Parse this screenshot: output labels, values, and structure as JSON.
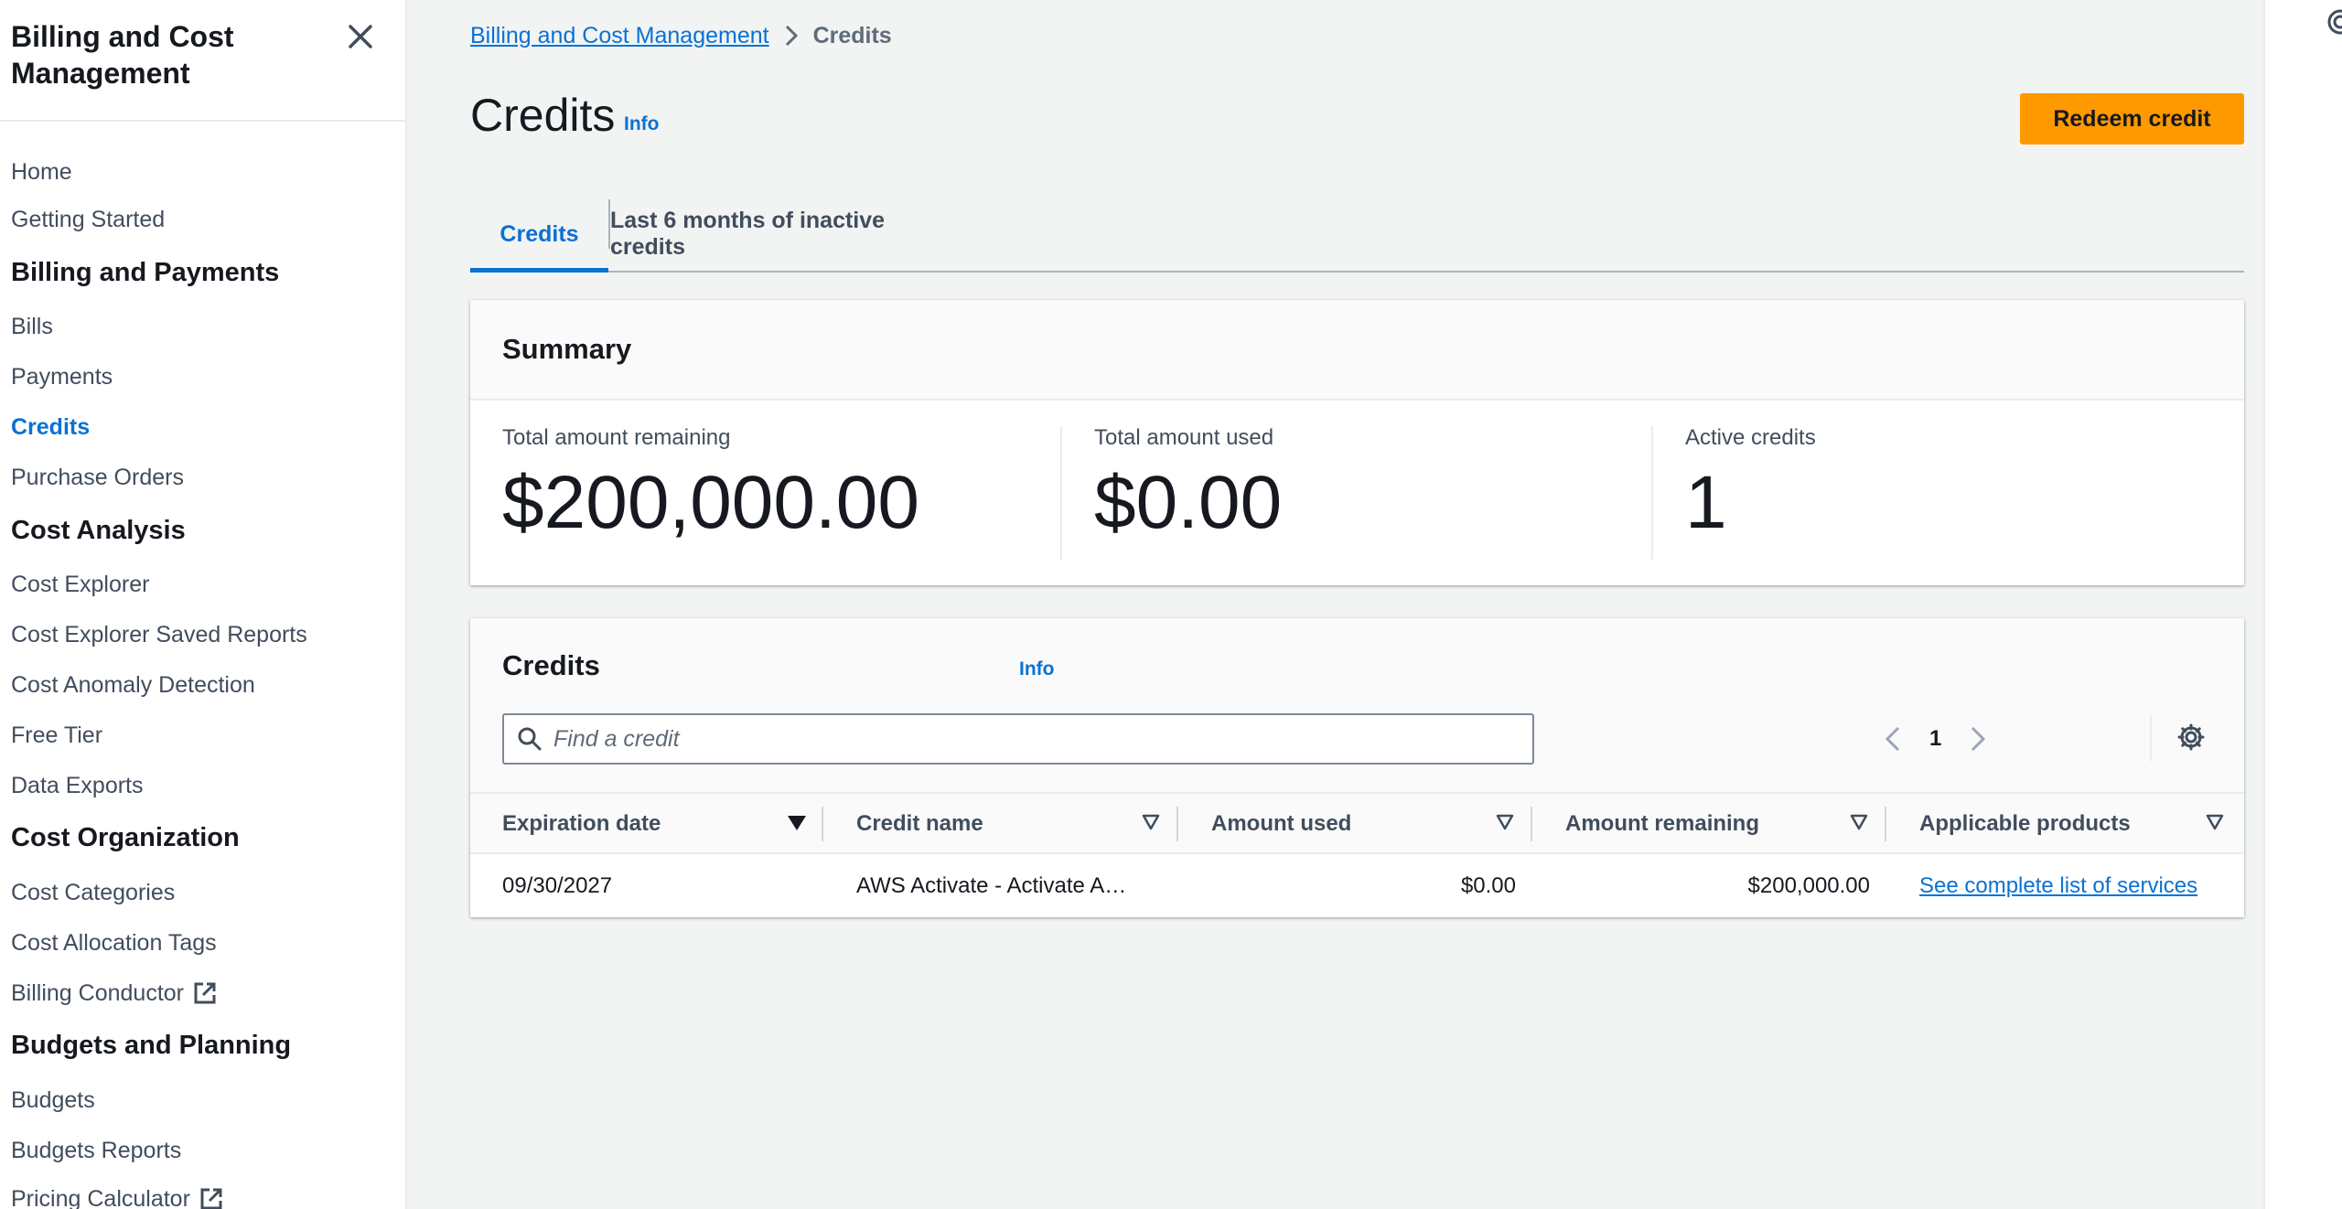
{
  "sidebar": {
    "title": "Billing and Cost Management",
    "links": {
      "home": "Home",
      "getting_started": "Getting Started",
      "bills": "Bills",
      "payments": "Payments",
      "credits": "Credits",
      "purchase_orders": "Purchase Orders",
      "cost_explorer": "Cost Explorer",
      "cost_explorer_saved_reports": "Cost Explorer Saved Reports",
      "cost_anomaly_detection": "Cost Anomaly Detection",
      "free_tier": "Free Tier",
      "data_exports": "Data Exports",
      "cost_categories": "Cost Categories",
      "cost_allocation_tags": "Cost Allocation Tags",
      "billing_conductor": "Billing Conductor",
      "budgets": "Budgets",
      "budgets_reports": "Budgets Reports",
      "pricing_calculator": "Pricing Calculator"
    },
    "sections": {
      "billing_and_payments": "Billing and Payments",
      "cost_analysis": "Cost Analysis",
      "cost_organization": "Cost Organization",
      "budgets_and_planning": "Budgets and Planning"
    },
    "active_item": "Credits"
  },
  "breadcrumb": {
    "parent": "Billing and Cost Management",
    "current": "Credits"
  },
  "page": {
    "title": "Credits",
    "info": "Info",
    "redeem_button": "Redeem credit"
  },
  "tabs": [
    {
      "label": "Credits",
      "active": true
    },
    {
      "label": "Last 6 months of inactive credits",
      "active": false
    }
  ],
  "summary": {
    "title": "Summary",
    "total_remaining_label": "Total amount remaining",
    "total_remaining_value": "$200,000.00",
    "total_used_label": "Total amount used",
    "total_used_value": "$0.00",
    "active_credits_label": "Active credits",
    "active_credits_value": "1"
  },
  "credits_table": {
    "title": "Credits",
    "info": "Info",
    "search_placeholder": "Find a credit",
    "current_page": "1",
    "columns": [
      "Expiration date",
      "Credit name",
      "Amount used",
      "Amount remaining",
      "Applicable products"
    ],
    "rows": [
      {
        "expiration_date": "09/30/2027",
        "credit_name": "AWS Activate - Activate A…",
        "amount_used": "$0.00",
        "amount_remaining": "$200,000.00",
        "applicable_products": "See complete list of services"
      }
    ]
  },
  "colors": {
    "accent": "#0972d3",
    "primary_button": "#ff9900",
    "background": "#f2f3f3"
  },
  "icons": {
    "close": "close-icon",
    "chevron_right": "chevron-right-icon",
    "external_link": "external-link-icon",
    "search": "search-icon",
    "chevron_left": "chevron-left-icon",
    "settings": "gear-icon",
    "sort_desc": "sort-descending-icon",
    "sort": "sort-icon"
  }
}
